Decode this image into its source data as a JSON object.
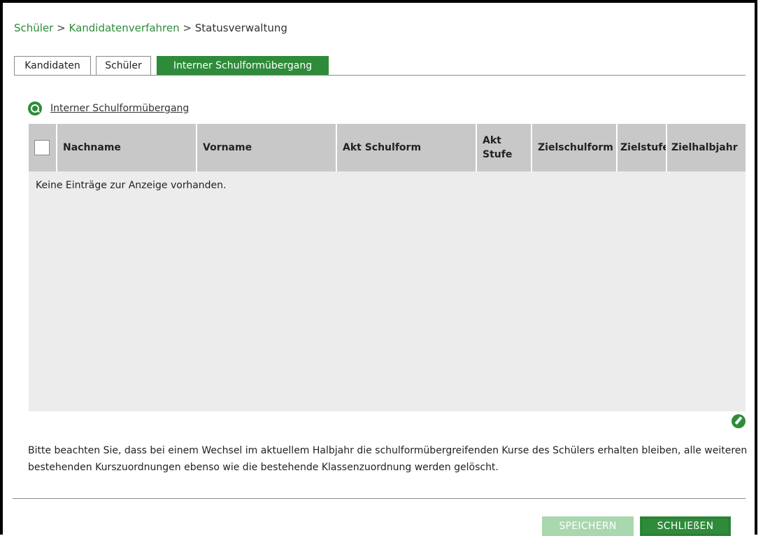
{
  "breadcrumb": {
    "item1": "Schüler",
    "item2": "Kandidatenverfahren",
    "separator": ">",
    "current": "Statusverwaltung"
  },
  "tabs": [
    {
      "label": "Kandidaten",
      "active": false
    },
    {
      "label": "Schüler",
      "active": false
    },
    {
      "label": "Interner Schulformübergang",
      "active": true
    }
  ],
  "section": {
    "icon": "search-icon",
    "title": "Interner Schulformübergang"
  },
  "table": {
    "columns": [
      "Nachname",
      "Vorname",
      "Akt Schulform",
      "Akt Stufe",
      "Zielschulform",
      "Zielstufe",
      "Zielhalbjahr"
    ],
    "empty_text": "Keine Einträge zur Anzeige vorhanden."
  },
  "edit_icon": "edit-icon",
  "note": "Bitte beachten Sie, dass bei einem Wechsel im aktuellem Halbjahr die schulformübergreifenden Kurse des Schülers erhalten bleiben, alle weiteren bestehenden Kurszuordnungen ebenso wie die bestehende Klassenzuordnung werden gelöscht.",
  "buttons": {
    "save": "SPEICHERN",
    "close": "SCHLIEßEN"
  },
  "colors": {
    "accent": "#2e8b3a",
    "accent_disabled": "#a9d7ae",
    "header_bg": "#c8c8c8",
    "table_bg": "#ececec"
  }
}
